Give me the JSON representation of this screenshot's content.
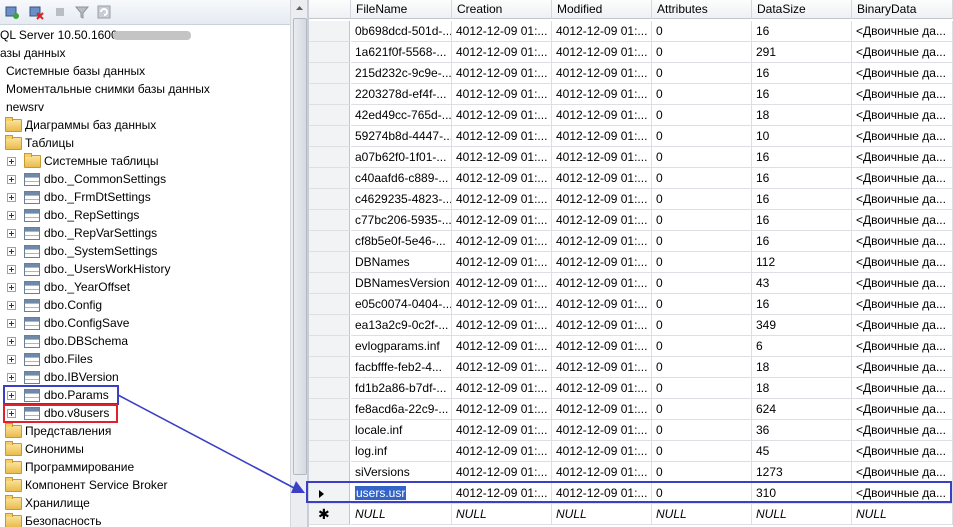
{
  "explorer": {
    "server_label": "QL Server 10.50.1600 - ",
    "items": [
      {
        "label": "азы данных"
      },
      {
        "label": "Системные базы данных"
      },
      {
        "label": "Моментальные снимки базы данных"
      },
      {
        "label": "newsrv"
      },
      {
        "label": "Диаграммы баз данных"
      },
      {
        "label": "Таблицы"
      },
      {
        "label": "Системные таблицы"
      },
      {
        "label": "dbo._CommonSettings"
      },
      {
        "label": "dbo._FrmDtSettings"
      },
      {
        "label": "dbo._RepSettings"
      },
      {
        "label": "dbo._RepVarSettings"
      },
      {
        "label": "dbo._SystemSettings"
      },
      {
        "label": "dbo._UsersWorkHistory"
      },
      {
        "label": "dbo._YearOffset"
      },
      {
        "label": "dbo.Config"
      },
      {
        "label": "dbo.ConfigSave"
      },
      {
        "label": "dbo.DBSchema"
      },
      {
        "label": "dbo.Files"
      },
      {
        "label": "dbo.IBVersion"
      },
      {
        "label": "dbo.Params"
      },
      {
        "label": "dbo.v8users"
      },
      {
        "label": "Представления"
      },
      {
        "label": "Синонимы"
      },
      {
        "label": "Программирование"
      },
      {
        "label": "Компонент Service Broker"
      },
      {
        "label": "Хранилище"
      },
      {
        "label": "Безопасность"
      }
    ]
  },
  "grid": {
    "columns": [
      "FileName",
      "Creation",
      "Modified",
      "Attributes",
      "DataSize",
      "BinaryData"
    ],
    "rows": [
      [
        "0b698dcd-501d-...",
        "4012-12-09 01:...",
        "4012-12-09 01:...",
        "0",
        "16",
        "<Двоичные да..."
      ],
      [
        "1a621f0f-5568-...",
        "4012-12-09 01:...",
        "4012-12-09 01:...",
        "0",
        "291",
        "<Двоичные да..."
      ],
      [
        "215d232c-9c9e-...",
        "4012-12-09 01:...",
        "4012-12-09 01:...",
        "0",
        "16",
        "<Двоичные да..."
      ],
      [
        "2203278d-ef4f-...",
        "4012-12-09 01:...",
        "4012-12-09 01:...",
        "0",
        "16",
        "<Двоичные да..."
      ],
      [
        "42ed49cc-765d-...",
        "4012-12-09 01:...",
        "4012-12-09 01:...",
        "0",
        "18",
        "<Двоичные да..."
      ],
      [
        "59274b8d-4447-...",
        "4012-12-09 01:...",
        "4012-12-09 01:...",
        "0",
        "10",
        "<Двоичные да..."
      ],
      [
        "a07b62f0-1f01-...",
        "4012-12-09 01:...",
        "4012-12-09 01:...",
        "0",
        "16",
        "<Двоичные да..."
      ],
      [
        "c40aafd6-c889-...",
        "4012-12-09 01:...",
        "4012-12-09 01:...",
        "0",
        "16",
        "<Двоичные да..."
      ],
      [
        "c4629235-4823-...",
        "4012-12-09 01:...",
        "4012-12-09 01:...",
        "0",
        "16",
        "<Двоичные да..."
      ],
      [
        "c77bc206-5935-...",
        "4012-12-09 01:...",
        "4012-12-09 01:...",
        "0",
        "16",
        "<Двоичные да..."
      ],
      [
        "cf8b5e0f-5e46-...",
        "4012-12-09 01:...",
        "4012-12-09 01:...",
        "0",
        "16",
        "<Двоичные да..."
      ],
      [
        "DBNames",
        "4012-12-09 01:...",
        "4012-12-09 01:...",
        "0",
        "112",
        "<Двоичные да..."
      ],
      [
        "DBNamesVersion",
        "4012-12-09 01:...",
        "4012-12-09 01:...",
        "0",
        "43",
        "<Двоичные да..."
      ],
      [
        "e05c0074-0404-...",
        "4012-12-09 01:...",
        "4012-12-09 01:...",
        "0",
        "16",
        "<Двоичные да..."
      ],
      [
        "ea13a2c9-0c2f-...",
        "4012-12-09 01:...",
        "4012-12-09 01:...",
        "0",
        "349",
        "<Двоичные да..."
      ],
      [
        "evlogparams.inf",
        "4012-12-09 01:...",
        "4012-12-09 01:...",
        "0",
        "6",
        "<Двоичные да..."
      ],
      [
        "facbfffe-feb2-4...",
        "4012-12-09 01:...",
        "4012-12-09 01:...",
        "0",
        "18",
        "<Двоичные да..."
      ],
      [
        "fd1b2a86-b7df-...",
        "4012-12-09 01:...",
        "4012-12-09 01:...",
        "0",
        "18",
        "<Двоичные да..."
      ],
      [
        "fe8acd6a-22c9-...",
        "4012-12-09 01:...",
        "4012-12-09 01:...",
        "0",
        "624",
        "<Двоичные да..."
      ],
      [
        "locale.inf",
        "4012-12-09 01:...",
        "4012-12-09 01:...",
        "0",
        "36",
        "<Двоичные да..."
      ],
      [
        "log.inf",
        "4012-12-09 01:...",
        "4012-12-09 01:...",
        "0",
        "45",
        "<Двоичные да..."
      ],
      [
        "siVersions",
        "4012-12-09 01:...",
        "4012-12-09 01:...",
        "0",
        "1273",
        "<Двоичные да..."
      ],
      [
        "users.usr",
        "4012-12-09 01:...",
        "4012-12-09 01:...",
        "0",
        "310",
        "<Двоичные да..."
      ]
    ],
    "selected_row": 22,
    "new_row": [
      "NULL",
      "NULL",
      "NULL",
      "NULL",
      "NULL",
      "NULL"
    ]
  },
  "colors": {
    "highlight_blue": "#3a3fc4",
    "highlight_red": "#e0202a",
    "selection": "#3465c6"
  }
}
